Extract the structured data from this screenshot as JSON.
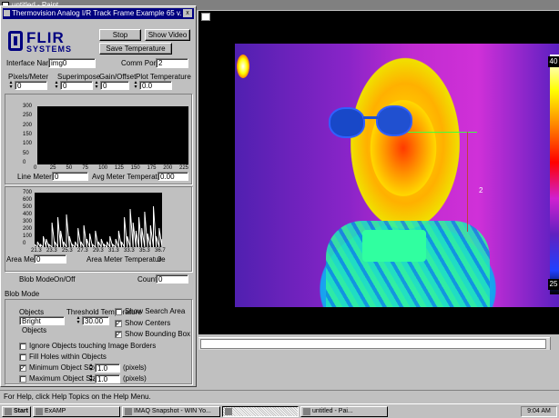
{
  "paint": {
    "title": "untitled - Paint",
    "status": "For Help, click Help Topics on the Help Menu."
  },
  "thermal": {
    "scale_top": "40",
    "scale_bottom": "25",
    "marker": "2"
  },
  "dialog": {
    "title": "Thermovision Analog I/R Track Frame Example 65 v.",
    "close_label": "x",
    "logo_line1": "FLIR",
    "logo_line2": "SYSTEMS",
    "stop_button": "Stop",
    "show_video_button": "Show Video",
    "save_temperature_button": "Save Temperature",
    "interface_name_label": "Interface Name",
    "interface_name_value": "img0",
    "comm_port_label": "Comm Port",
    "comm_port_value": "2",
    "params": [
      {
        "label": "Pixels/Meter",
        "value": "0"
      },
      {
        "label": "Superimpose",
        "value": "0"
      },
      {
        "label": "Gain/Offset",
        "value": "0"
      },
      {
        "label": "Plot Temperature",
        "value": "0.0"
      }
    ],
    "plot1": {
      "y_ticks": [
        "300",
        "250",
        "200",
        "150",
        "100",
        "50",
        "0"
      ],
      "x_ticks": [
        "0",
        "25",
        "50",
        "75",
        "100",
        "125",
        "150",
        "175",
        "200",
        "225"
      ]
    },
    "line_meter_label": "Line Meter",
    "line_meter_value": "0",
    "avg_temp_label": "Avg Meter Temperature",
    "avg_temp_value": "0.00",
    "plot2": {
      "y_ticks": [
        "700",
        "600",
        "500",
        "400",
        "300",
        "200",
        "100",
        "0"
      ],
      "x_ticks": [
        "21.3",
        "23.3",
        "25.3",
        "27.3",
        "29.3",
        "31.3",
        "33.3",
        "35.3",
        "36.7"
      ],
      "histogram": [
        0.05,
        0.1,
        0.05,
        0.2,
        0.15,
        0.05,
        0.45,
        0.1,
        0.55,
        0.3,
        0.1,
        0.6,
        0.2,
        0.05,
        0.1,
        0.35,
        0.1,
        0.4,
        0.15,
        0.25,
        0.05,
        0.3,
        0.1,
        0.15,
        0.05,
        0.1,
        0.2,
        0.05,
        0.15,
        0.3,
        0.1,
        0.55,
        0.2,
        0.7,
        0.45,
        0.3,
        0.55,
        0.35,
        0.65,
        0.25,
        0.4,
        0.75,
        0.2,
        0.35,
        0.15
      ]
    },
    "area_meter_label": "Area Meter",
    "area_meter_value": "0",
    "area_temp_label": "Area Meter Temperature",
    "area_temp_value": "0",
    "blob_mode_label": "Blob Mode",
    "blob_mode_value": "On/Off",
    "count_label": "Count",
    "count_value": "0",
    "blob_group_label": "Blob Mode",
    "objects_label": "Objects",
    "objects_value": "Bright Objects",
    "threshold_label": "Threshold Temperature",
    "threshold_value": "30.00",
    "show_search_area": "Show Search Area",
    "show_centers": "Show Centers",
    "show_bounding_box": "Show Bounding Box",
    "ignore_objects": "Ignore Objects touching Image Borders",
    "fill_holes": "Fill Holes within Objects",
    "min_size_label": "Minimum Object Size",
    "min_size_value": "1.0",
    "min_size_unit": "(pixels)",
    "max_size_label": "Maximum Object Size",
    "max_size_value": "1.0",
    "max_size_unit": "(pixels)"
  },
  "taskbar": {
    "start": "Start",
    "tasks": [
      "ExAMP",
      "IMAQ Snapshot - WIN Yo...",
      "",
      "untitled - Pai..."
    ],
    "clock": "9:04 AM"
  }
}
